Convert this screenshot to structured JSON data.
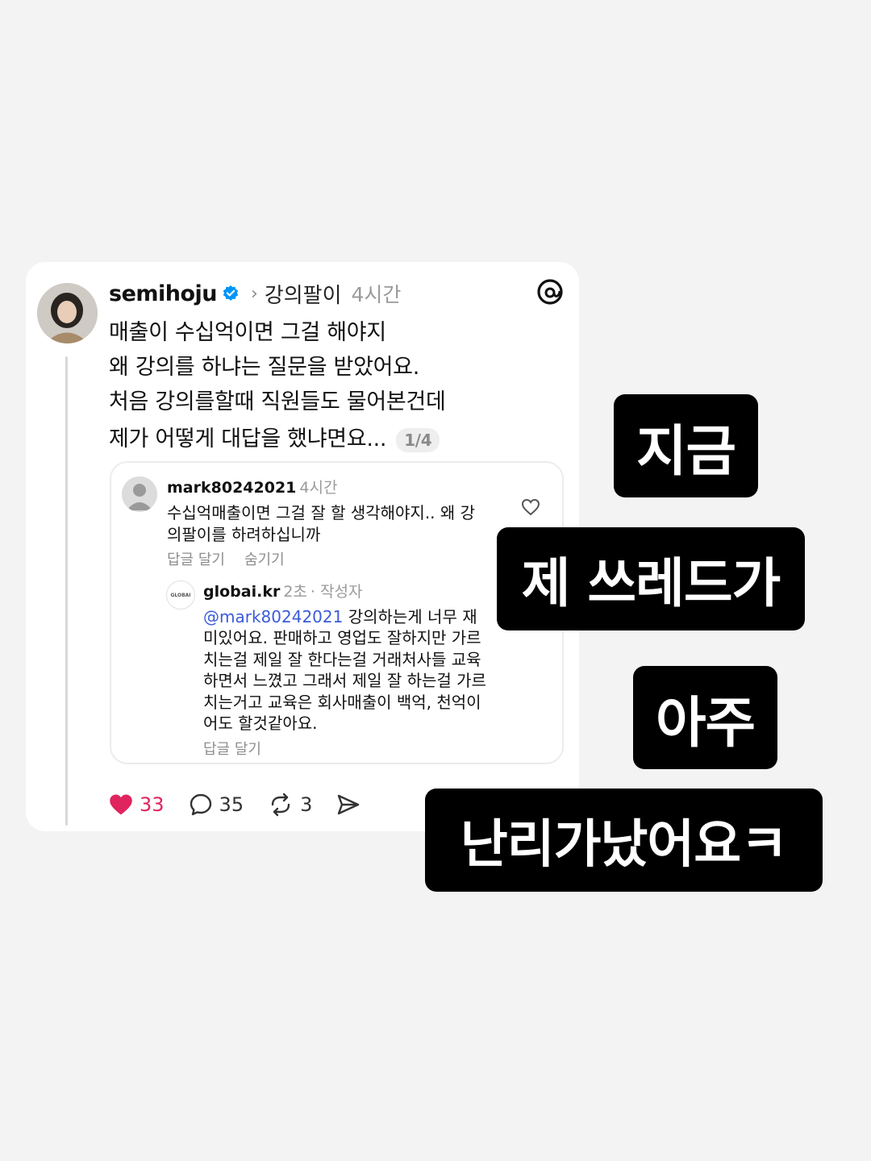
{
  "post": {
    "username": "semihoju",
    "topic": "강의팔이",
    "time": "4시간",
    "lines": [
      "매출이 수십억이면 그걸 해야지",
      "왜 강의를 하냐는 질문을 받았어요.",
      "처음 강의를할때 직원들도 물어본건데",
      "제가 어떻게 대답을 했냐면요..."
    ],
    "pager": "1/4"
  },
  "comment": {
    "username": "mark80242021",
    "time": "4시간",
    "lines": [
      "수십억매출이면 그걸 잘 할 생각해야지.. 왜 강",
      "의팔이를 하려하십니까"
    ],
    "reply_label": "답글 달기",
    "hide_label": "숨기기"
  },
  "reply": {
    "avatar_text": "GLOBAI",
    "username": "globai.kr",
    "time": "2초",
    "author_badge": "· 작성자",
    "mention": "@mark80242021",
    "first_line_rest": " 강의하는게 너무 재",
    "lines": [
      "미있어요. 판매하고 영업도 잘하지만 가르",
      "치는걸 제일 잘 한다는걸 거래처사들 교육",
      "하면서 느꼈고 그래서 제일 잘 하는걸 가르",
      "치는거고 교육은 회사매출이 백억, 천억이",
      "어도 할것같아요."
    ],
    "reply_label": "답글 달기"
  },
  "actions": {
    "likes": "33",
    "comments": "35",
    "reposts": "3"
  },
  "overlay_tags": [
    "지금",
    "제 쓰레드가",
    "아주",
    "난리가났어요ㅋ"
  ],
  "colors": {
    "like": "#e0245e",
    "mention": "#3a5bd9",
    "verified": "#0095f6",
    "tag_bg": "#000000"
  }
}
